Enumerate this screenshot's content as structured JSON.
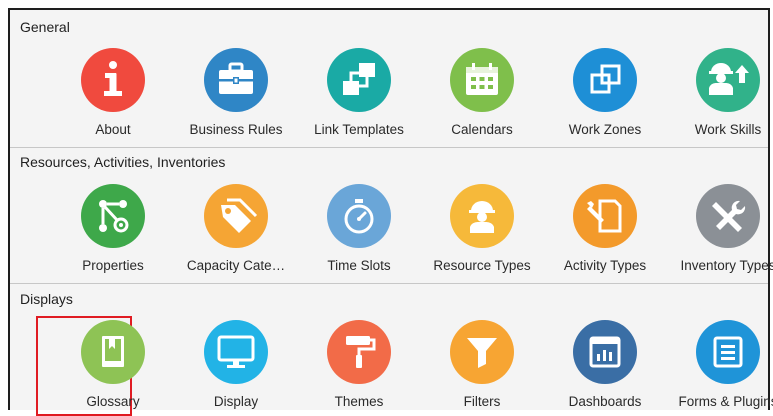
{
  "sections": [
    {
      "title": "General",
      "items": [
        {
          "label": "About",
          "icon": "info-icon",
          "color": "#f04a3e"
        },
        {
          "label": "Business Rules",
          "icon": "briefcase-icon",
          "color": "#2f86c6"
        },
        {
          "label": "Link Templates",
          "icon": "link-templates-icon",
          "color": "#1aaaa5"
        },
        {
          "label": "Calendars",
          "icon": "calendar-icon",
          "color": "#7fbf4b"
        },
        {
          "label": "Work Zones",
          "icon": "work-zones-icon",
          "color": "#1e8fd6"
        },
        {
          "label": "Work Skills",
          "icon": "work-skills-icon",
          "color": "#31b28a"
        }
      ]
    },
    {
      "title": "Resources, Activities, Inventories",
      "items": [
        {
          "label": "Properties",
          "icon": "properties-icon",
          "color": "#3ea84a"
        },
        {
          "label": "Capacity Cate…",
          "icon": "tags-icon",
          "color": "#f5a534"
        },
        {
          "label": "Time Slots",
          "icon": "stopwatch-icon",
          "color": "#6aa6d8"
        },
        {
          "label": "Resource Types",
          "icon": "worker-icon",
          "color": "#f6b93a"
        },
        {
          "label": "Activity Types",
          "icon": "activity-icon",
          "color": "#f39a2b"
        },
        {
          "label": "Inventory Types",
          "icon": "tools-icon",
          "color": "#8b9096"
        }
      ]
    },
    {
      "title": "Displays",
      "items": [
        {
          "label": "Glossary",
          "icon": "book-icon",
          "color": "#8ec355"
        },
        {
          "label": "Display",
          "icon": "monitor-icon",
          "color": "#22b3e6"
        },
        {
          "label": "Themes",
          "icon": "paint-roller-icon",
          "color": "#f26b48"
        },
        {
          "label": "Filters",
          "icon": "filter-icon",
          "color": "#f7a533"
        },
        {
          "label": "Dashboards",
          "icon": "dashboard-icon",
          "color": "#3a6ea5"
        },
        {
          "label": "Forms & Plugins",
          "icon": "forms-icon",
          "color": "#1f94d8"
        }
      ]
    }
  ],
  "selected_item": "Glossary"
}
